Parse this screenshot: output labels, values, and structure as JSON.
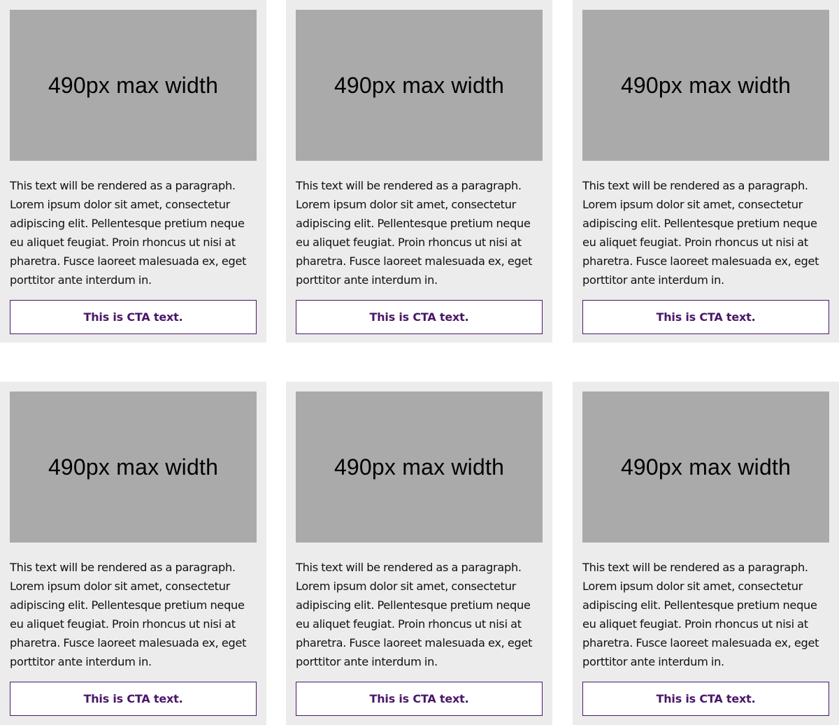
{
  "colors": {
    "page_background": "#ffffff",
    "card_background": "#ececec",
    "image_placeholder": "#aaaaaa",
    "cta_accent": "#4a1769"
  },
  "cards": [
    {
      "image_label": "490px max width",
      "paragraph": "This text will be rendered as a paragraph. Lorem ipsum dolor sit amet, consectetur adipiscing elit. Pellentesque pretium neque eu aliquet feugiat. Proin rhoncus ut nisi at pharetra. Fusce laoreet malesuada ex, eget porttitor ante interdum in.",
      "cta_label": "This is CTA text."
    },
    {
      "image_label": "490px max width",
      "paragraph": "This text will be rendered as a paragraph. Lorem ipsum dolor sit amet, consectetur adipiscing elit. Pellentesque pretium neque eu aliquet feugiat. Proin rhoncus ut nisi at pharetra. Fusce laoreet malesuada ex, eget porttitor ante interdum in.",
      "cta_label": "This is CTA text."
    },
    {
      "image_label": "490px max width",
      "paragraph": "This text will be rendered as a paragraph. Lorem ipsum dolor sit amet, consectetur adipiscing elit. Pellentesque pretium neque eu aliquet feugiat. Proin rhoncus ut nisi at pharetra. Fusce laoreet malesuada ex, eget porttitor ante interdum in.",
      "cta_label": "This is CTA text."
    },
    {
      "image_label": "490px max width",
      "paragraph": "This text will be rendered as a paragraph. Lorem ipsum dolor sit amet, consectetur adipiscing elit. Pellentesque pretium neque eu aliquet feugiat. Proin rhoncus ut nisi at pharetra. Fusce laoreet malesuada ex, eget porttitor ante interdum in.",
      "cta_label": "This is CTA text."
    },
    {
      "image_label": "490px max width",
      "paragraph": "This text will be rendered as a paragraph. Lorem ipsum dolor sit amet, consectetur adipiscing elit. Pellentesque pretium neque eu aliquet feugiat. Proin rhoncus ut nisi at pharetra. Fusce laoreet malesuada ex, eget porttitor ante interdum in.",
      "cta_label": "This is CTA text."
    },
    {
      "image_label": "490px max width",
      "paragraph": "This text will be rendered as a paragraph. Lorem ipsum dolor sit amet, consectetur adipiscing elit. Pellentesque pretium neque eu aliquet feugiat. Proin rhoncus ut nisi at pharetra. Fusce laoreet malesuada ex, eget porttitor ante interdum in.",
      "cta_label": "This is CTA text."
    }
  ]
}
